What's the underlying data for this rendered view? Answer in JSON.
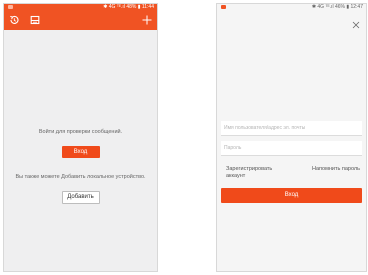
{
  "colors": {
    "accent": "#f05323",
    "button": "#f04a1a",
    "background": "#efeff0"
  },
  "left_screen": {
    "status_bar": {
      "text": "✱ 4G ᵀᴱ.ıl 48% ▮ 11:44"
    },
    "app_bar": {
      "icons": [
        "history-icon",
        "inbox-icon",
        "plus-icon"
      ]
    },
    "login_prompt": "Войти для проверки сообщений.",
    "login_button": "Вход",
    "local_device_prompt": "Вы также можете Добавить локальное устройство.",
    "add_button": "Добавить"
  },
  "right_screen": {
    "status_bar": {
      "text": "✱ 4G ᵀᴱ.ıl 46% ▮ 12:47"
    },
    "close_icon": "close-icon",
    "username_placeholder": "Имя пользователя/адрес эл. почты",
    "password_placeholder": "Пароль",
    "register_link": "Зарегистрировать аккаунт",
    "forgot_password_link": "Напомнить пароль",
    "login_button": "Вход"
  }
}
